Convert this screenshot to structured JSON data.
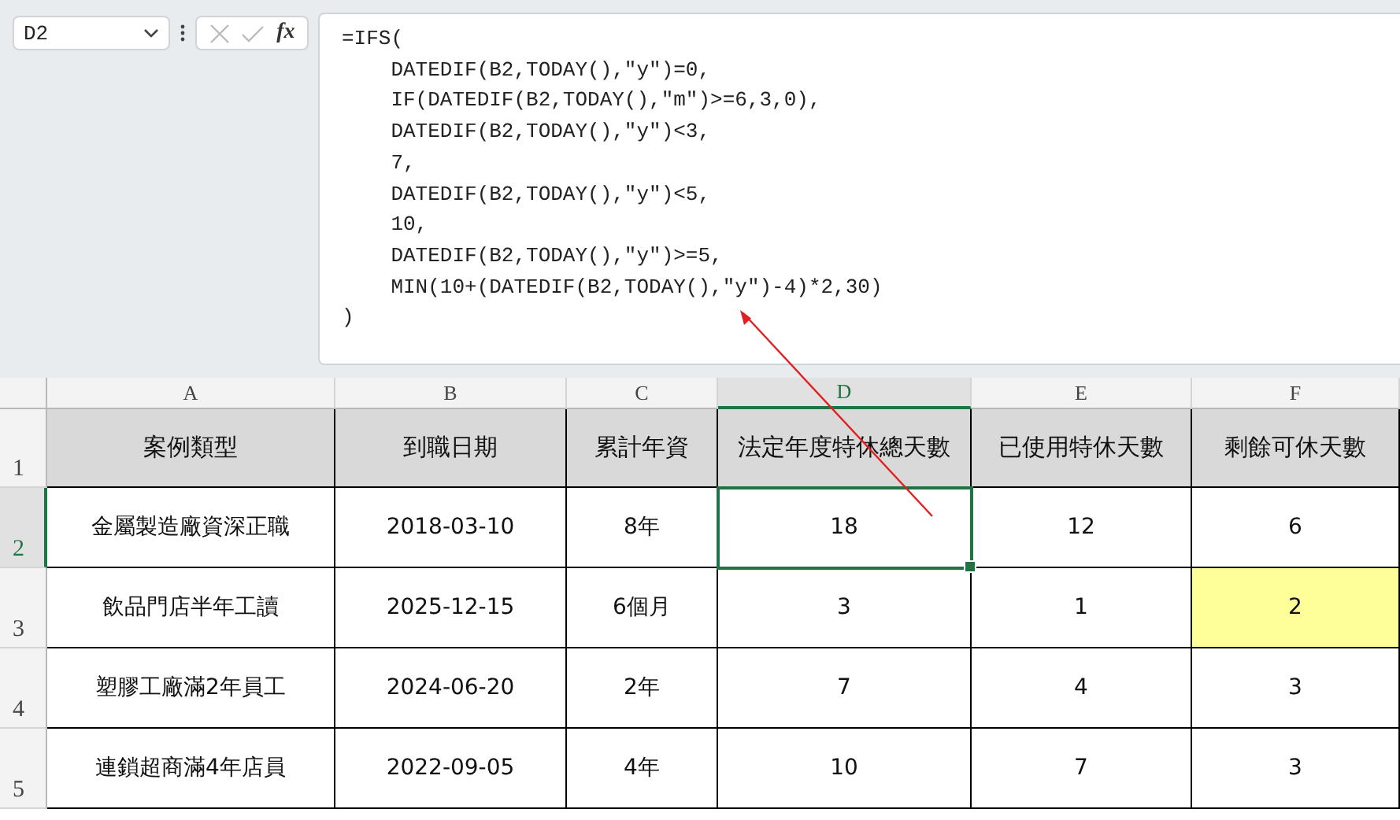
{
  "name_box": {
    "value": "D2"
  },
  "formula_bar": {
    "function_label": "fx",
    "lines": [
      "=IFS(",
      "    DATEDIF(B2,TODAY(),\"y\")=0,",
      "    IF(DATEDIF(B2,TODAY(),\"m\")>=6,3,0),",
      "    DATEDIF(B2,TODAY(),\"y\")<3,",
      "    7,",
      "    DATEDIF(B2,TODAY(),\"y\")<5,",
      "    10,",
      "    DATEDIF(B2,TODAY(),\"y\")>=5,",
      "    MIN(10+(DATEDIF(B2,TODAY(),\"y\")-4)*2,30)",
      ")"
    ]
  },
  "columns": [
    {
      "label": "A",
      "selected": false
    },
    {
      "label": "B",
      "selected": false
    },
    {
      "label": "C",
      "selected": false
    },
    {
      "label": "D",
      "selected": true
    },
    {
      "label": "E",
      "selected": false
    },
    {
      "label": "F",
      "selected": false
    }
  ],
  "rows": [
    {
      "number": "1",
      "kind": "header",
      "selected": false,
      "cells": [
        {
          "text": "案例類型",
          "selected": false,
          "highlighted": false
        },
        {
          "text": "到職日期",
          "selected": false,
          "highlighted": false
        },
        {
          "text": "累計年資",
          "selected": false,
          "highlighted": false
        },
        {
          "text": "法定年度特休總天數",
          "selected": false,
          "highlighted": false
        },
        {
          "text": "已使用特休天數",
          "selected": false,
          "highlighted": false
        },
        {
          "text": "剩餘可休天數",
          "selected": false,
          "highlighted": false
        }
      ]
    },
    {
      "number": "2",
      "kind": "data",
      "selected": true,
      "cells": [
        {
          "text": "金屬製造廠資深正職",
          "selected": false,
          "highlighted": false
        },
        {
          "text": "2018-03-10",
          "selected": false,
          "highlighted": false
        },
        {
          "text": "8年",
          "selected": false,
          "highlighted": false
        },
        {
          "text": "18",
          "selected": true,
          "highlighted": false
        },
        {
          "text": "12",
          "selected": false,
          "highlighted": false
        },
        {
          "text": "6",
          "selected": false,
          "highlighted": false
        }
      ]
    },
    {
      "number": "3",
      "kind": "data",
      "selected": false,
      "cells": [
        {
          "text": "飲品門店半年工讀",
          "selected": false,
          "highlighted": false
        },
        {
          "text": "2025-12-15",
          "selected": false,
          "highlighted": false
        },
        {
          "text": "6個月",
          "selected": false,
          "highlighted": false
        },
        {
          "text": "3",
          "selected": false,
          "highlighted": false
        },
        {
          "text": "1",
          "selected": false,
          "highlighted": false
        },
        {
          "text": "2",
          "selected": false,
          "highlighted": true
        }
      ]
    },
    {
      "number": "4",
      "kind": "data",
      "selected": false,
      "cells": [
        {
          "text": "塑膠工廠滿2年員工",
          "selected": false,
          "highlighted": false
        },
        {
          "text": "2024-06-20",
          "selected": false,
          "highlighted": false
        },
        {
          "text": "2年",
          "selected": false,
          "highlighted": false
        },
        {
          "text": "7",
          "selected": false,
          "highlighted": false
        },
        {
          "text": "4",
          "selected": false,
          "highlighted": false
        },
        {
          "text": "3",
          "selected": false,
          "highlighted": false
        }
      ]
    },
    {
      "number": "5",
      "kind": "data",
      "selected": false,
      "cells": [
        {
          "text": "連鎖超商滿4年店員",
          "selected": false,
          "highlighted": false
        },
        {
          "text": "2022-09-05",
          "selected": false,
          "highlighted": false
        },
        {
          "text": "4年",
          "selected": false,
          "highlighted": false
        },
        {
          "text": "10",
          "selected": false,
          "highlighted": false
        },
        {
          "text": "7",
          "selected": false,
          "highlighted": false
        },
        {
          "text": "3",
          "selected": false,
          "highlighted": false
        }
      ]
    }
  ]
}
